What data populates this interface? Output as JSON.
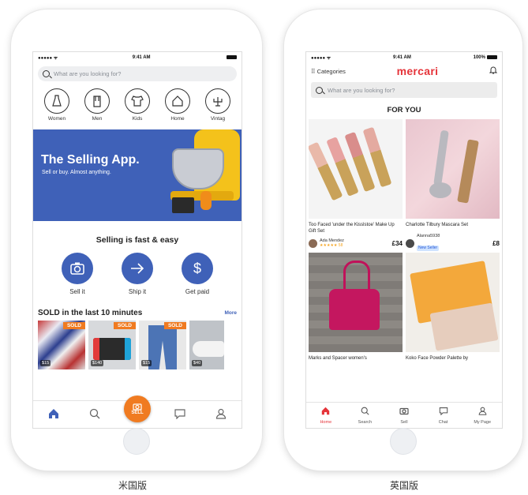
{
  "us": {
    "status": {
      "carrier": "●●●●● ᯤ",
      "time": "9:41 AM"
    },
    "search_placeholder": "What are you looking for?",
    "categories": [
      {
        "label": "Women",
        "icon": "dress-icon"
      },
      {
        "label": "Men",
        "icon": "shirt-icon"
      },
      {
        "label": "Kids",
        "icon": "onesie-icon"
      },
      {
        "label": "Home",
        "icon": "house-icon"
      },
      {
        "label": "Vintag",
        "icon": "candelabra-icon"
      }
    ],
    "banner": {
      "title": "The Selling App.",
      "subtitle": "Sell or buy. Almost anything."
    },
    "fast_title": "Selling is fast & easy",
    "actions": [
      {
        "label": "Sell it",
        "icon": "camera-icon"
      },
      {
        "label": "Ship it",
        "icon": "arrow-right-icon"
      },
      {
        "label": "Get paid",
        "icon": "dollar-icon"
      }
    ],
    "sold": {
      "title": "SOLD in the last 10 minutes",
      "more": "More",
      "tag": "SOLD",
      "items": [
        {
          "price": "$15"
        },
        {
          "price": "$140"
        },
        {
          "price": "$15"
        },
        {
          "price": "$40"
        }
      ]
    },
    "tabs": {
      "sell": "SELL"
    }
  },
  "uk": {
    "status": {
      "carrier": "●●●●● ᯤ",
      "time": "9:41 AM",
      "battery": "100%"
    },
    "categories_label": "Categories",
    "logo": "mercari",
    "search_placeholder": "What are you looking for?",
    "section_title": "FOR YOU",
    "items": [
      {
        "title": "Too Faced 'under the Kisslstoe' Make Up Gift Set",
        "seller": "Ada Mendez",
        "rating": "★★★★★ 58",
        "price": "£34"
      },
      {
        "title": "Charlotte Tilbury Mascara Set",
        "seller": "Alanna5938",
        "badge": "New Seller",
        "price": "£8"
      },
      {
        "title": "Marks and Spacer women's"
      },
      {
        "title": "Koko Face Powder Palette by"
      }
    ],
    "tabs": [
      {
        "label": "Home",
        "icon": "home-icon"
      },
      {
        "label": "Search",
        "icon": "search-icon"
      },
      {
        "label": "Sell",
        "icon": "camera-icon"
      },
      {
        "label": "Chat",
        "icon": "chat-icon"
      },
      {
        "label": "My Page",
        "icon": "person-icon"
      }
    ]
  },
  "captions": {
    "us": "米国版",
    "uk": "英国版"
  }
}
